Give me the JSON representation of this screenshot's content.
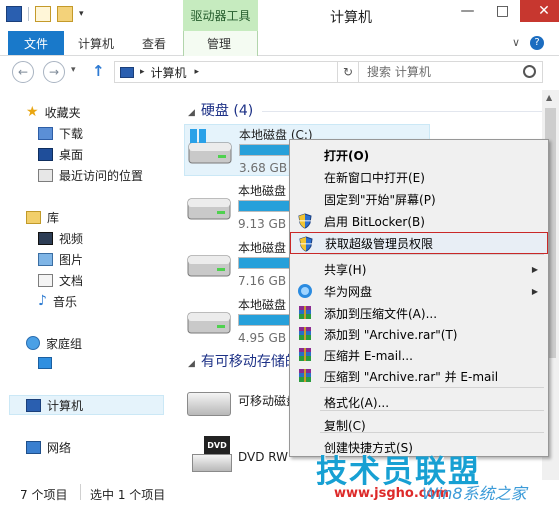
{
  "window": {
    "title": "计算机",
    "context_tab_group": "驱动器工具",
    "controls": {
      "minimize": "—",
      "maximize": "□",
      "close": "✕"
    }
  },
  "ribbon": {
    "tabs": [
      "文件",
      "计算机",
      "查看",
      "管理"
    ],
    "collapse_glyph": "∨",
    "help_glyph": "?"
  },
  "address_bar": {
    "back": "←",
    "forward": "→",
    "history": "▾",
    "up": "↑",
    "breadcrumb": [
      "计算机"
    ],
    "separator": "▸",
    "refresh": "↻",
    "search_placeholder": "搜索 计算机"
  },
  "nav_pane": {
    "favorites": {
      "label": "收藏夹",
      "items": [
        "下载",
        "桌面",
        "最近访问的位置"
      ]
    },
    "libraries": {
      "label": "库",
      "items": [
        "视频",
        "图片",
        "文档",
        "音乐"
      ]
    },
    "homegroup": "家庭组",
    "computer": "计算机",
    "network": "网络"
  },
  "content": {
    "hard_disks_header": "硬盘 (4)",
    "removable_header": "有可移动存储的",
    "drives": [
      {
        "name": "本地磁盘 (C:)",
        "size": "3.68 GB 可",
        "used_fraction": 0.7
      },
      {
        "name": "本地磁盘",
        "size": "9.13 GB 可",
        "used_fraction": 0.65
      },
      {
        "name": "本地磁盘",
        "size": "7.16 GB 可",
        "used_fraction": 0.6
      },
      {
        "name": "本地磁盘",
        "size": "4.95 GB 可",
        "used_fraction": 0.75
      }
    ],
    "removable": [
      {
        "name": "可移动磁盘"
      },
      {
        "name": "DVD RW"
      }
    ]
  },
  "status_bar": {
    "item_count": "7 个项目",
    "selected": "选中 1 个项目"
  },
  "context_menu": {
    "items": [
      {
        "label": "打开(O)",
        "bold": true
      },
      {
        "label": "在新窗口中打开(E)"
      },
      {
        "label": "固定到\"开始\"屏幕(P)"
      },
      {
        "label": "启用 BitLocker(B)",
        "icon": "shield-icon"
      },
      {
        "label": "获取超级管理员权限",
        "icon": "shield-icon",
        "highlighted": true
      },
      {
        "label": "共享(H)",
        "submenu": true
      },
      {
        "label": "华为网盘",
        "icon": "cloud-icon",
        "submenu": true
      },
      {
        "label": "添加到压缩文件(A)...",
        "icon": "winrar-icon"
      },
      {
        "label": "添加到 \"Archive.rar\"(T)",
        "icon": "winrar-icon"
      },
      {
        "label": "压缩并 E-mail...",
        "icon": "winrar-icon"
      },
      {
        "label": "压缩到 \"Archive.rar\" 并 E-mail",
        "icon": "winrar-icon"
      },
      {
        "label": "格式化(A)..."
      },
      {
        "label": "复制(C)"
      },
      {
        "label": "创建快捷方式(S)"
      }
    ]
  },
  "watermark": {
    "brand": "技术员联盟",
    "url": "www.jsgho.com",
    "url2": "Win8系统之家"
  }
}
